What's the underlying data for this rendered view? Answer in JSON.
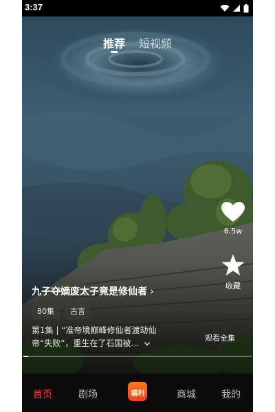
{
  "status_bar": {
    "time": "3:37",
    "icons": [
      "wifi-icon",
      "signal-icon",
      "battery-icon"
    ]
  },
  "top_tabs": [
    {
      "label": "推荐",
      "active": true
    },
    {
      "label": "短视频",
      "active": false
    }
  ],
  "actions": {
    "like_count": "6.5w",
    "favorite_label": "收藏"
  },
  "drama": {
    "title": "九子夺嫡废太子竟是修仙者",
    "title_chevron": "›",
    "tags": [
      "80集",
      "古言"
    ],
    "description_line1": "第1集 | “准帝境巅峰修仙者渡劫仙",
    "description_line2": "帝“失败”，重生在了石国被…",
    "expand_icon": "chevron-down-icon",
    "watch_all": "观看全集",
    "progress_fraction": 0.02
  },
  "bottom_nav": {
    "items": [
      "首页",
      "剧场",
      "福利",
      "商城",
      "我的"
    ],
    "active_index": 0,
    "welfare_label": "福利"
  },
  "colors": {
    "active_nav": "#ff3b3b",
    "welfare_badge": "#f23a2d"
  }
}
